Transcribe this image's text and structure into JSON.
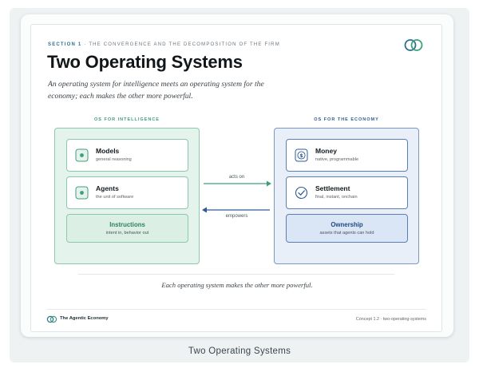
{
  "header": {
    "section": "SECTION 1",
    "section_sep": " · ",
    "section_topic": "THE CONVERGENCE AND THE DECOMPOSITION OF THE FIRM",
    "title": "Two Operating Systems",
    "subtitle": "An operating system for intelligence meets an operating system for the economy; each makes the other more powerful."
  },
  "left_column": {
    "label": "OS FOR INTELLIGENCE",
    "items": [
      {
        "name": "Models",
        "desc": "general reasoning",
        "icon": "dot-square-icon"
      },
      {
        "name": "Agents",
        "desc": "the unit of software",
        "icon": "dot-square-icon"
      }
    ],
    "base": {
      "name": "Instructions",
      "desc": "intent in, behavior out"
    }
  },
  "right_column": {
    "label": "OS FOR THE ECONOMY",
    "items": [
      {
        "name": "Money",
        "desc": "native, programmable",
        "icon": "dollar-circle-icon"
      },
      {
        "name": "Settlement",
        "desc": "final, instant, onchain",
        "icon": "check-circle-icon"
      }
    ],
    "base": {
      "name": "Ownership",
      "desc": "assets that agents can hold"
    }
  },
  "arrows": {
    "forward_label": "acts on",
    "backward_label": "empowers"
  },
  "caption": "Each operating system makes the other more powerful.",
  "footer": {
    "brand": "The Agentic Economy",
    "concept": "Concept 1.2 · two-operating-systems"
  },
  "page_caption": "Two Operating Systems",
  "colors": {
    "intelligence_accent": "#3f9d7c",
    "economy_accent": "#2f5b93",
    "intelligence_fill": "#e4f3ec",
    "economy_fill": "#e9eff8"
  }
}
